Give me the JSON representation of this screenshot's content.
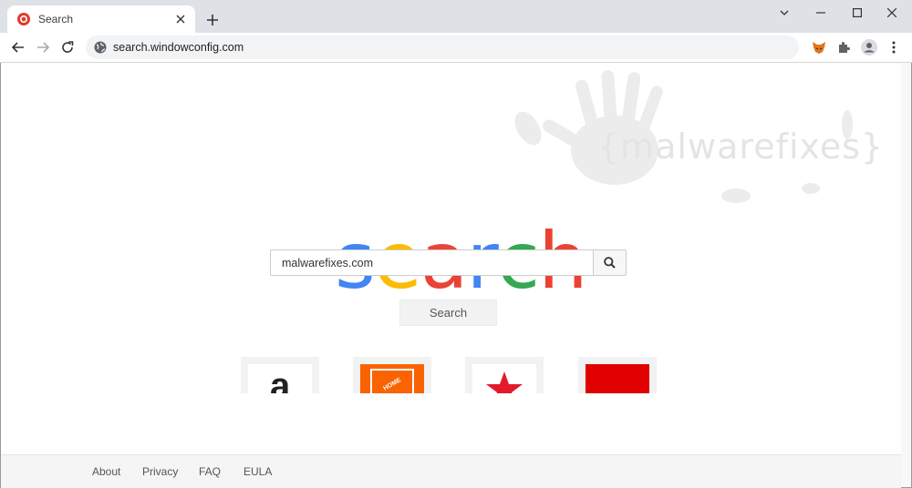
{
  "browser": {
    "tab_title": "Search",
    "url": "search.windowconfig.com"
  },
  "watermark": {
    "text": "{malwarefixes}"
  },
  "logo": {
    "letters": [
      {
        "char": "s",
        "color": "#4285f4"
      },
      {
        "char": "e",
        "color": "#fbbc05"
      },
      {
        "char": "a",
        "color": "#ea4335"
      },
      {
        "char": "r",
        "color": "#4285f4"
      },
      {
        "char": "c",
        "color": "#34a853"
      },
      {
        "char": "h",
        "color": "#ea4335"
      }
    ]
  },
  "search": {
    "input_value": "malwarefixes.com",
    "button_label": "Search"
  },
  "tiles": [
    {
      "name": "amazon",
      "glyph": "a",
      "bg": "#ffffff"
    },
    {
      "name": "the-home-depot",
      "glyph": "THE HOME DEPOT",
      "bg": "#f96302"
    },
    {
      "name": "macys",
      "glyph": "★",
      "bg": "#ffffff"
    },
    {
      "name": "red-tile",
      "glyph": "",
      "bg": "#e00000"
    }
  ],
  "footer": {
    "links": [
      "About",
      "Privacy",
      "FAQ",
      "EULA"
    ]
  }
}
